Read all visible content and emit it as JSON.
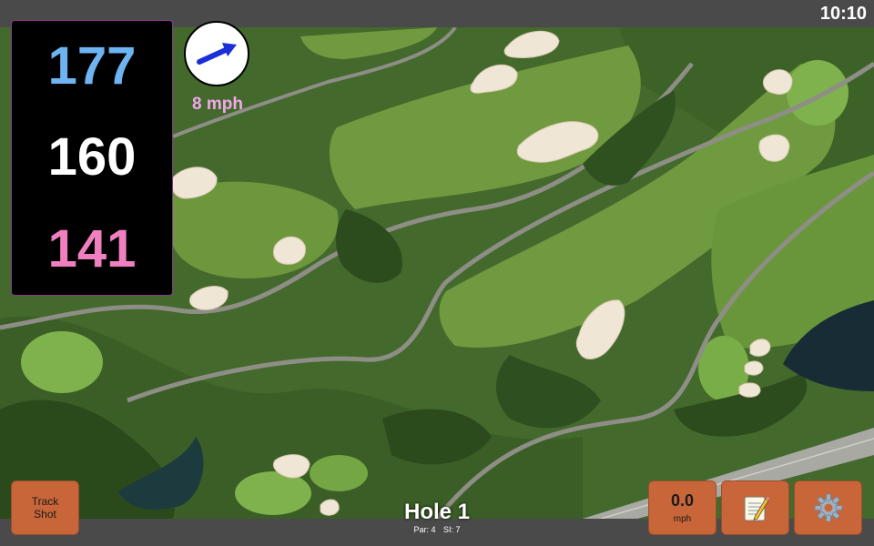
{
  "status_bar": {
    "time": "10:10"
  },
  "distances": {
    "back": "177",
    "center": "160",
    "front": "141"
  },
  "wind": {
    "speed_label": "8 mph",
    "icon": "arrow-right-icon"
  },
  "buttons": {
    "track_shot": "Track Shot",
    "speed_value": "0.0",
    "speed_unit": "mph",
    "notes_icon": "notepad-icon",
    "settings_icon": "gear-icon"
  },
  "hole": {
    "title": "Hole 1",
    "par_label": "Par: 4",
    "si_label": "SI: 7"
  },
  "colors": {
    "back_distance": "#6fb4f2",
    "center_distance": "#ffffff",
    "front_distance": "#f07fc0",
    "wind_text": "#f2a8ea",
    "button": "#c8663a",
    "frame_accent": "#8a3a8a"
  }
}
